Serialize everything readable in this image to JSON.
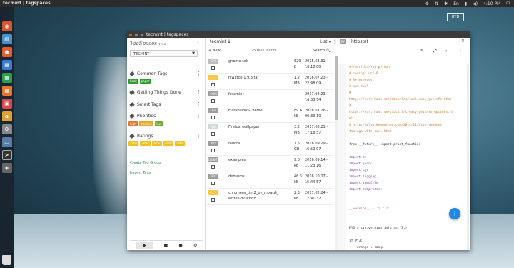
{
  "desktop": {
    "panel_title": "tecmint | tagspaces",
    "time": "4:10 PM",
    "hyd_label": "HYD"
  },
  "window": {
    "title": "tecmint | tagspaces"
  },
  "sidebar": {
    "logo": "TagSpaces",
    "version": "1.7.8",
    "location": "TECMINT",
    "groups": [
      {
        "label": "Common Tags",
        "tags": [
          {
            "t": "book",
            "c": "#2e9d2e"
          },
          {
            "t": "paper",
            "c": "#2e9d2e"
          }
        ]
      },
      {
        "label": "Getting Things Done",
        "tags": []
      },
      {
        "label": "Smart Tags",
        "tags": []
      },
      {
        "label": "Priorities",
        "tags": [
          {
            "t": "high",
            "c": "#e8762c"
          },
          {
            "t": "medium",
            "c": "#e8a92c"
          },
          {
            "t": "low",
            "c": "#6aab2e"
          }
        ]
      },
      {
        "label": "Ratings",
        "tags": [
          {
            "t": "1star",
            "c": "#f0c020"
          },
          {
            "t": "2star",
            "c": "#f0c020"
          },
          {
            "t": "3star",
            "c": "#f0c020"
          },
          {
            "t": "4star",
            "c": "#f0c020"
          },
          {
            "t": "5star",
            "c": "#f0c020"
          }
        ]
      }
    ],
    "create_link": "Create Tag Group",
    "import_link": "Import Tags"
  },
  "files": {
    "location": "tecmint",
    "list_label": "List",
    "new_label": "New",
    "count": "25 files found",
    "search_label": "Search",
    "rows": [
      {
        "ext": "GPS",
        "ec": "#bdbdbd",
        "name": "gnome-sdk",
        "size": "629 B",
        "date": "2015.03.31 - 16:18:00"
      },
      {
        "ext": "",
        "ec": "#f7c948",
        "name": "fswatch-1.9.3.tar",
        "size": "1.2 MB",
        "date": "2016.07.23 - 22:48:09"
      },
      {
        "ext": "COM",
        "ec": "#9e9e9e",
        "name": "fossmint",
        "size": "",
        "date": "2017.02.23 - 16:38:54"
      },
      {
        "ext": "DEB",
        "ec": "#9e9e9e",
        "name": "Flatabulous-Theme",
        "size": "89.6 kB",
        "date": "2016.07.26 - 00:33:10"
      },
      {
        "ext": "PNG",
        "ec": "#cfd8dc",
        "name": "Firefox_wallpaper",
        "size": "3.2 MB",
        "date": "2017.03.21 - 17:18:57"
      },
      {
        "ext": "ISO",
        "ec": "#9e9e9e",
        "name": "fedora",
        "size": "1.5 GB",
        "date": "2016.09.29 - 16:52:07"
      },
      {
        "ext": "DESKTOP",
        "ec": "#9e9e9e",
        "name": "examples",
        "size": "9.0 kB",
        "date": "2016.09.14 - 11:23:16"
      },
      {
        "ext": "TEXT",
        "ec": "#9e9e9e",
        "name": "debsums",
        "size": "46.5 kB",
        "date": "2016.10.07 - 15:44:57"
      },
      {
        "ext": "",
        "ec": "#f7c948",
        "name": "chromeos_tint2_by_mowgli_ writes-d7sk6dz",
        "size": "2.3 kB",
        "date": "2017.02.24 - 17:41:32"
      }
    ]
  },
  "viewer": {
    "ext": "PY",
    "file": "httpstat",
    "fab": "⋮",
    "lines": [
      {
        "t": "#!/usr/bin/env python",
        "cl": "c"
      },
      {
        "t": "# coding: utf-8",
        "cl": "c"
      },
      {
        "t": "# References:",
        "cl": "c"
      },
      {
        "t": "# man curl",
        "cl": "c"
      },
      {
        "t": "#",
        "cl": "c"
      },
      {
        "t": "https://curl.haxx.se/libcurl/c/curl_easy_getinfo.html",
        "cl": "c"
      },
      {
        "t": "#",
        "cl": "c"
      },
      {
        "t": "https://curl.haxx.se/libcurl/c/easy_getinfo_options.ht",
        "cl": "c"
      },
      {
        "t": "ml",
        "cl": "c"
      },
      {
        "t": "# http://blog.kenweiner.com/2014/11/http-request-",
        "cl": "c"
      },
      {
        "t": "timings-with-curl.html",
        "cl": "c"
      },
      {
        "t": "",
        "cl": "n"
      },
      {
        "t": "from __future__ import print_function",
        "cl": "n"
      },
      {
        "t": "",
        "cl": "n"
      },
      {
        "t": "import os",
        "cl": "k"
      },
      {
        "t": "import json",
        "cl": "k"
      },
      {
        "t": "import sys",
        "cl": "k"
      },
      {
        "t": "import logging",
        "cl": "k"
      },
      {
        "t": "import tempfile",
        "cl": "k"
      },
      {
        "t": "import subprocess",
        "cl": "k"
      },
      {
        "t": "",
        "cl": "n"
      },
      {
        "t": "",
        "cl": "n"
      },
      {
        "t": "__version__ = '1.2.1'",
        "cl": "s"
      },
      {
        "t": "",
        "cl": "n"
      },
      {
        "t": "",
        "cl": "n"
      },
      {
        "t": "PY3 = sys.version_info >= (3,)",
        "cl": "n"
      },
      {
        "t": "",
        "cl": "n"
      },
      {
        "t": "if PY3:",
        "cl": "n"
      },
      {
        "t": "    xrange = range",
        "cl": "n"
      }
    ]
  }
}
